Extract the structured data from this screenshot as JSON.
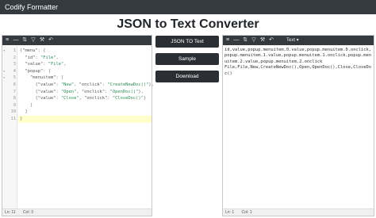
{
  "app": {
    "brand": "Codify Formatter"
  },
  "page": {
    "title": "JSON to Text Converter"
  },
  "left_editor": {
    "lines": [
      {
        "num": "1",
        "fold": "▾",
        "segments": [
          [
            "p",
            "{"
          ],
          [
            "k",
            "\"menu\""
          ],
          [
            "p",
            ": {"
          ]
        ]
      },
      {
        "num": "2",
        "fold": "",
        "segments": [
          [
            "p",
            "  "
          ],
          [
            "k",
            "\"id\""
          ],
          [
            "p",
            ": "
          ],
          [
            "s",
            "\"File\""
          ],
          [
            "p",
            ","
          ]
        ]
      },
      {
        "num": "3",
        "fold": "",
        "segments": [
          [
            "p",
            "  "
          ],
          [
            "k",
            "\"value\""
          ],
          [
            "p",
            ": "
          ],
          [
            "s",
            "\"File\""
          ],
          [
            "p",
            ","
          ]
        ]
      },
      {
        "num": "4",
        "fold": "▾",
        "segments": [
          [
            "p",
            "  "
          ],
          [
            "k",
            "\"popup\""
          ],
          [
            "p",
            ": {"
          ]
        ]
      },
      {
        "num": "5",
        "fold": "▾",
        "segments": [
          [
            "p",
            "    "
          ],
          [
            "k",
            "\"menuitem\""
          ],
          [
            "p",
            ": ["
          ]
        ]
      },
      {
        "num": "6",
        "fold": "",
        "segments": [
          [
            "p",
            "      {"
          ],
          [
            "k",
            "\"value\""
          ],
          [
            "p",
            ": "
          ],
          [
            "s",
            "\"New\""
          ],
          [
            "p",
            ", "
          ],
          [
            "k",
            "\"onclick\""
          ],
          [
            "p",
            ": "
          ],
          [
            "s",
            "\"CreateNewDoc()\""
          ],
          [
            "p",
            "},"
          ]
        ]
      },
      {
        "num": "7",
        "fold": "",
        "segments": [
          [
            "p",
            "      {"
          ],
          [
            "k",
            "\"value\""
          ],
          [
            "p",
            ": "
          ],
          [
            "s",
            "\"Open\""
          ],
          [
            "p",
            ", "
          ],
          [
            "k",
            "\"onclick\""
          ],
          [
            "p",
            ": "
          ],
          [
            "s",
            "\"OpenDoc()\""
          ],
          [
            "p",
            "},"
          ]
        ]
      },
      {
        "num": "8",
        "fold": "",
        "segments": [
          [
            "p",
            "      {"
          ],
          [
            "k",
            "\"value\""
          ],
          [
            "p",
            ": "
          ],
          [
            "s",
            "\"Close\""
          ],
          [
            "p",
            ", "
          ],
          [
            "k",
            "\"onclick\""
          ],
          [
            "p",
            ": "
          ],
          [
            "s",
            "\"CloseDoc()\""
          ],
          [
            "p",
            "}"
          ]
        ]
      },
      {
        "num": "9",
        "fold": "",
        "segments": [
          [
            "p",
            "    ]"
          ]
        ]
      },
      {
        "num": "10",
        "fold": "",
        "segments": [
          [
            "p",
            "  }"
          ]
        ]
      },
      {
        "num": "11",
        "fold": "",
        "segments": [
          [
            "p",
            "}"
          ]
        ]
      }
    ],
    "status": {
      "line": "Ln: 11",
      "col": "Col: 3"
    }
  },
  "buttons": {
    "convert": "JSON TO Text",
    "sample": "Sample",
    "download": "Download"
  },
  "right_editor": {
    "format_dropdown": "Text ▾",
    "output": "id,value,popup.menuitem.0.value,popup.menuitem.0.onclick,popup.menuitem.1.value,popup.menuitem.1.onclick,popup.menuitem.2.value,popup.menuitem.2.onclick\nFile,File,New,CreateNewDoc(),Open,OpenDoc(),Close,CloseDoc()",
    "status": {
      "line": "Ln: 1",
      "col": "Col: 1"
    }
  },
  "toolbar_icons": [
    "format-icon",
    "compact-icon",
    "sort-icon",
    "filter-icon",
    "transform-icon",
    "repair-icon",
    "undo-icon"
  ],
  "colors": {
    "topbar": "#343a40",
    "button": "#2b2f33",
    "string": "#2e8b57"
  }
}
